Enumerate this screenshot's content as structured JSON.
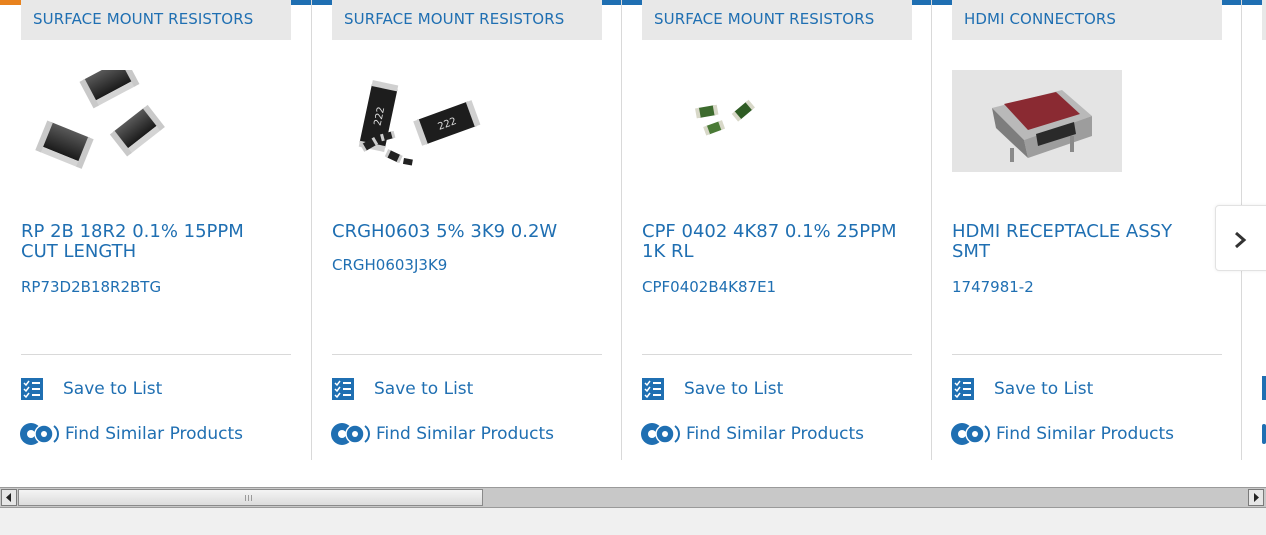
{
  "colors": {
    "link": "#1f6fb2",
    "accent": "#e8821e",
    "category_bg": "#e8e8e8"
  },
  "actions": {
    "save_label": "Save to List",
    "similar_label": "Find Similar Products",
    "save_icon": "checklist-icon",
    "similar_icon": "gears-icon"
  },
  "products": [
    {
      "category": "SURFACE MOUNT RESISTORS",
      "title": "RP 2B 18R2 0.1% 15PPM CUT LENGTH",
      "part_number": "RP73D2B18R2BTG",
      "image": "smd-resistors-black"
    },
    {
      "category": "SURFACE MOUNT RESISTORS",
      "title": "CRGH0603 5% 3K9 0.2W",
      "part_number": "CRGH0603J3K9",
      "image": "smd-resistors-222"
    },
    {
      "category": "SURFACE MOUNT RESISTORS",
      "title": "CPF 0402 4K87 0.1% 25PPM 1K RL",
      "part_number": "CPF0402B4K87E1",
      "image": "smd-resistors-green"
    },
    {
      "category": "HDMI CONNECTORS",
      "title": "HDMI RECEPTACLE ASSY SMT",
      "part_number": "1747981-2",
      "image": "hdmi-receptacle"
    }
  ],
  "carousel": {
    "next_icon": "chevron-right-icon"
  },
  "scrollbar": {
    "left_arrow": "◀",
    "right_arrow": "▶"
  }
}
